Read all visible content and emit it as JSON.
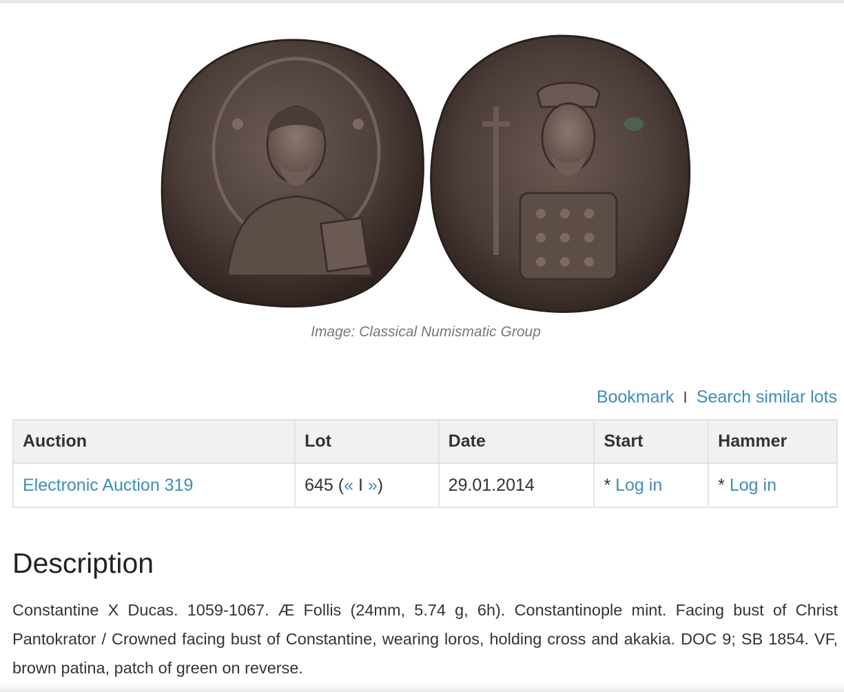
{
  "image": {
    "alt": "coin-obverse-and-reverse",
    "caption": "Image: Classical Numismatic Group"
  },
  "actions": {
    "bookmark": "Bookmark",
    "separator": "I",
    "search_similar": "Search similar lots"
  },
  "table": {
    "headers": [
      "Auction",
      "Lot",
      "Date",
      "Start",
      "Hammer"
    ],
    "row": {
      "auction": "Electronic Auction 319",
      "lot_number": "645 (",
      "lot_prev": "«",
      "lot_sep": " I ",
      "lot_next": "»",
      "lot_close": ")",
      "date": "29.01.2014",
      "start_prefix": "* ",
      "start_link": "Log in",
      "hammer_prefix": "* ",
      "hammer_link": "Log in"
    }
  },
  "description": {
    "title": "Description",
    "text": "Constantine X Ducas. 1059-1067. Æ Follis (24mm, 5.74 g, 6h). Constantinople mint. Facing bust of Christ Pantokrator / Crowned facing bust of Constantine, wearing loros, holding cross and akakia. DOC 9; SB 1854. VF, brown patina, patch of green on reverse."
  },
  "colors": {
    "link": "#3a8fc0",
    "header_bg": "#f1f1f1",
    "coin_bronze": "#4a3a34"
  }
}
